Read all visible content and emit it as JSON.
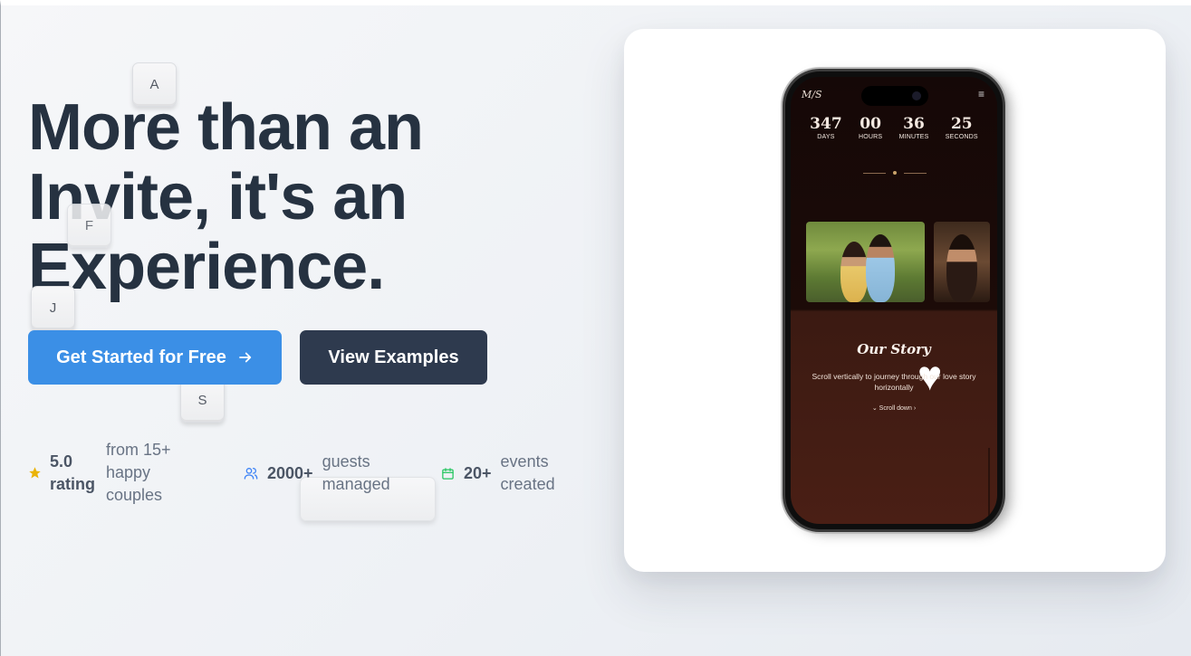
{
  "hero": {
    "line1": "More than an",
    "line2": "Invite, it's an",
    "line3": "Experience."
  },
  "keycaps": [
    "A",
    "F",
    "J",
    "S"
  ],
  "actions": {
    "primary_label": "Get Started for Free",
    "secondary_label": "View Examples"
  },
  "stats": [
    {
      "icon": "star-icon",
      "value_line1": "5.0",
      "value_line2": "rating",
      "desc": [
        "from 15+",
        "happy",
        "couples"
      ]
    },
    {
      "icon": "users-icon",
      "value": "2000+",
      "desc": [
        "guests",
        "managed"
      ]
    },
    {
      "icon": "calendar-icon",
      "value": "20+",
      "desc": [
        "events",
        "created"
      ]
    }
  ],
  "phone": {
    "logo": "M/S",
    "countdown": [
      {
        "num": "347",
        "label": "DAYS"
      },
      {
        "num": "00",
        "label": "HOURS"
      },
      {
        "num": "36",
        "label": "MINUTES"
      },
      {
        "num": "25",
        "label": "SECONDS"
      }
    ],
    "story_title": "Our Story",
    "story_text": "Scroll vertically to journey through our love story horizontally",
    "scroll_hint": "Scroll down"
  },
  "colors": {
    "primary": "#3b8fe6",
    "dark": "#2e3a4e",
    "heading": "#263241",
    "star": "#eab308",
    "users": "#3b82f6",
    "calendar": "#22c55e"
  }
}
